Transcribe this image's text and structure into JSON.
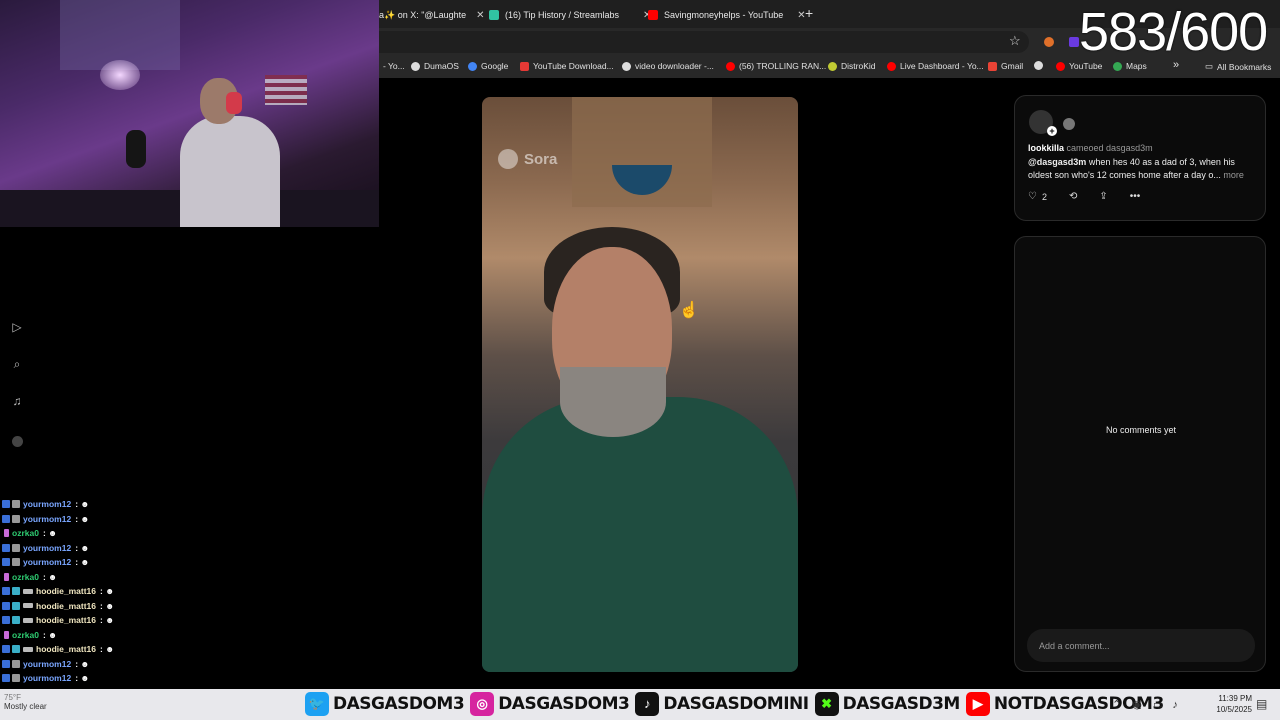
{
  "browser": {
    "tabs": [
      {
        "label": "a✨ on X: \"@Laughte",
        "color": "#1d1d1d"
      },
      {
        "label": "(16) Tip History / Streamlabs",
        "color": "#31c3a2"
      },
      {
        "label": "Savingmoneyhelps - YouTube",
        "color": "#ff0000"
      }
    ],
    "new_tab_glyph": "+",
    "bookmarks": [
      {
        "label": "- Yo...",
        "color": "#888"
      },
      {
        "label": "DumaOS",
        "color": "#ddd"
      },
      {
        "label": "Google",
        "color": "#4285f4"
      },
      {
        "label": "YouTube Download...",
        "color": "#e53935"
      },
      {
        "label": "video downloader -...",
        "color": "#ddd"
      },
      {
        "label": "(56) TROLLING RAN...",
        "color": "#ff0000"
      },
      {
        "label": "DistroKid",
        "color": "#c0ca33"
      },
      {
        "label": "Live Dashboard - Yo...",
        "color": "#ff0000"
      },
      {
        "label": "Gmail",
        "color": "#ea4335"
      },
      {
        "label": "",
        "color": "#ddd"
      },
      {
        "label": "YouTube",
        "color": "#ff0000"
      },
      {
        "label": "Maps",
        "color": "#34a853"
      }
    ],
    "all_bookmarks": "All Bookmarks"
  },
  "overlay": {
    "counter": "583/600"
  },
  "chat": [
    {
      "user": "yourmom12",
      "color": "#7aa6ff",
      "badges": 2
    },
    {
      "user": "yourmom12",
      "color": "#7aa6ff",
      "badges": 2
    },
    {
      "user": "ozrka0",
      "color": "#2ecc71",
      "badges": 1
    },
    {
      "user": "yourmom12",
      "color": "#7aa6ff",
      "badges": 2
    },
    {
      "user": "yourmom12",
      "color": "#7aa6ff",
      "badges": 2
    },
    {
      "user": "ozrka0",
      "color": "#2ecc71",
      "badges": 1
    },
    {
      "user": "hoodie_matt16",
      "color": "#f0e6c0",
      "badges": 3
    },
    {
      "user": "hoodie_matt16",
      "color": "#f0e6c0",
      "badges": 3
    },
    {
      "user": "hoodie_matt16",
      "color": "#f0e6c0",
      "badges": 3
    },
    {
      "user": "ozrka0",
      "color": "#2ecc71",
      "badges": 1
    },
    {
      "user": "hoodie_matt16",
      "color": "#f0e6c0",
      "badges": 3
    },
    {
      "user": "yourmom12",
      "color": "#7aa6ff",
      "badges": 2
    },
    {
      "user": "yourmom12",
      "color": "#7aa6ff",
      "badges": 2
    }
  ],
  "video": {
    "watermark": "Sora"
  },
  "post": {
    "username": "lookkilla",
    "action": "cameoed dasgasd3m",
    "mention": "@dasgasd3m",
    "caption": " when hes 40 as a dad of 3, when his oldest son who's 12 comes home after a day o...",
    "more": "more",
    "likes": "2"
  },
  "comments": {
    "empty_text": "No comments yet",
    "placeholder": "Add a comment..."
  },
  "taskbar": {
    "weather_temp": "75°F",
    "weather_desc": "Mostly clear",
    "socials": [
      {
        "handle": "DASGASDOM3",
        "icon": "twitter-icon",
        "color": "#1da1f2",
        "glyph": "🐦"
      },
      {
        "handle": "DASGASDOM3",
        "icon": "instagram-icon",
        "color": "#d6249f",
        "glyph": "◎"
      },
      {
        "handle": "DASGASDOMINI",
        "icon": "tiktok-icon",
        "color": "#111111",
        "glyph": "♪"
      },
      {
        "handle": "DASGASD3M",
        "icon": "kick-icon",
        "color": "#111111",
        "glyph": "✖"
      },
      {
        "handle": "NOTDASGASDOM3",
        "icon": "youtube-icon",
        "color": "#ff0000",
        "glyph": "▶"
      }
    ],
    "time": "11:39 PM",
    "date": "10/5/2025"
  }
}
